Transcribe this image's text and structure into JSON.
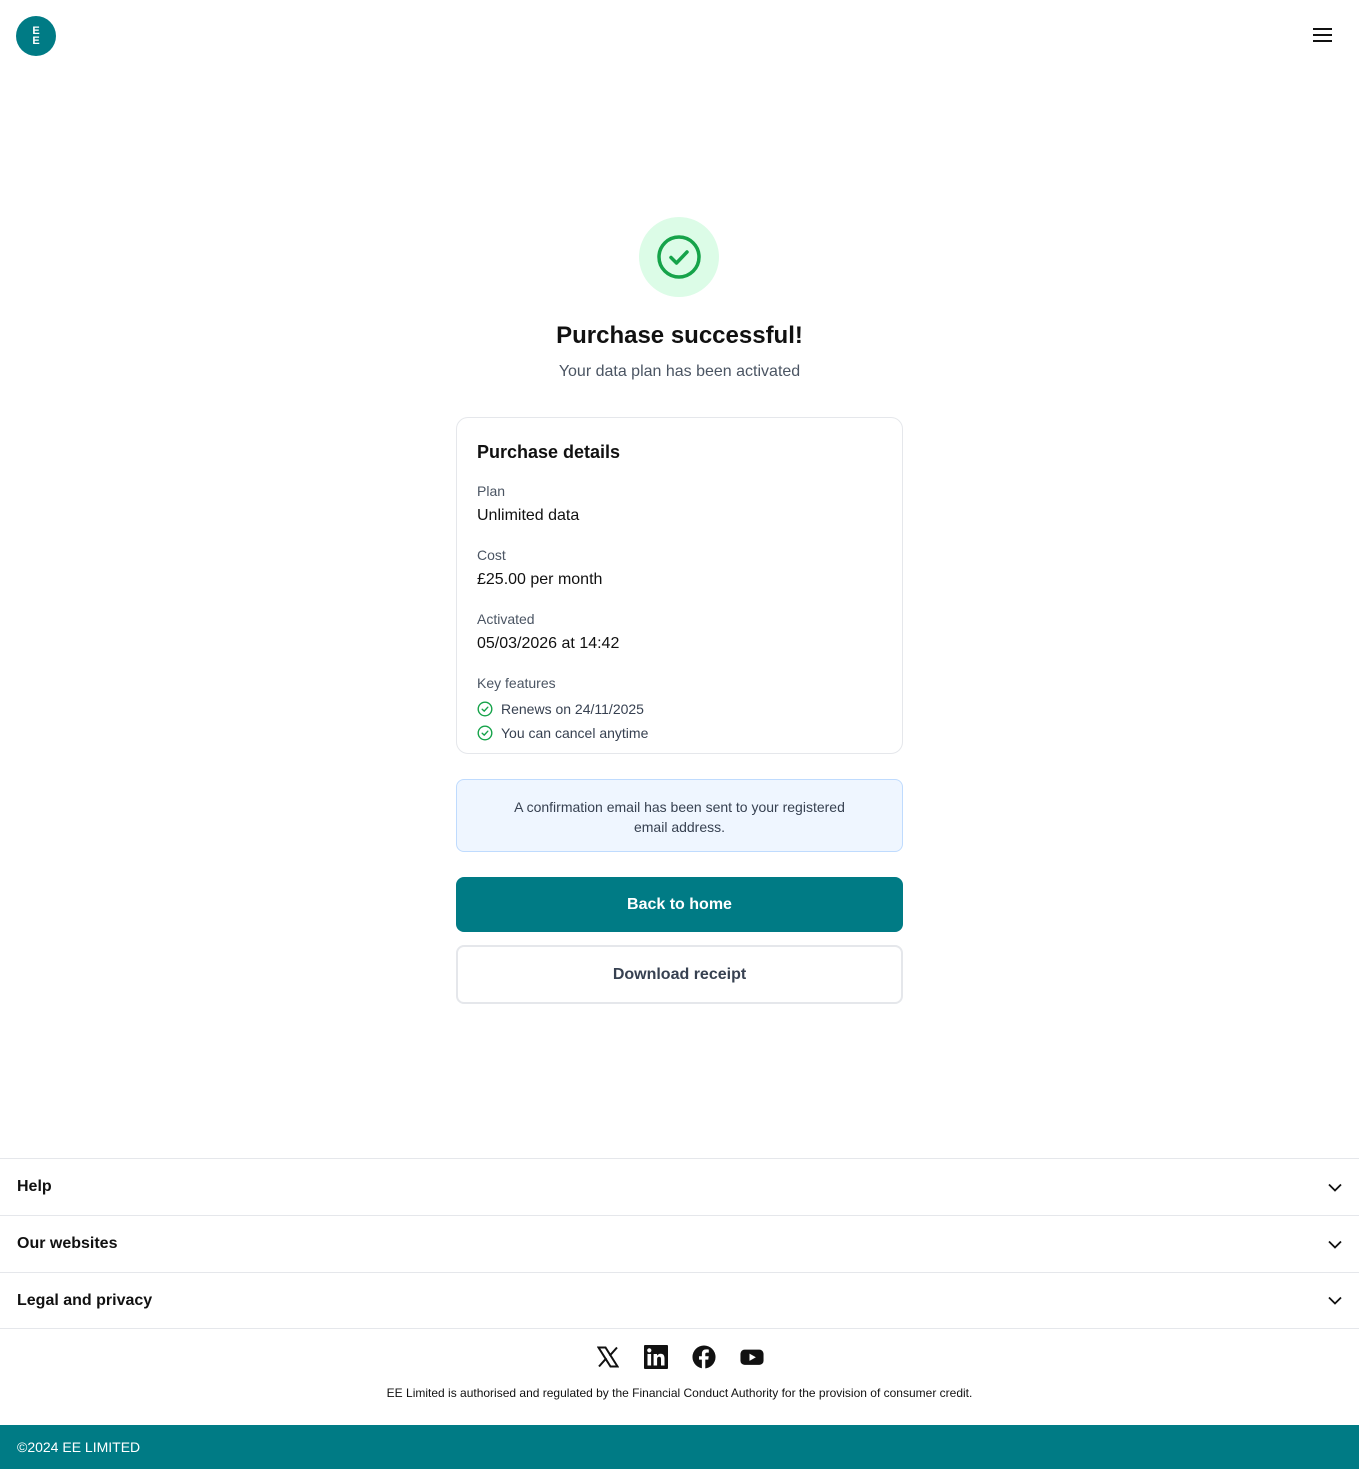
{
  "header": {
    "logo_line1": "E",
    "logo_line2": "E"
  },
  "main": {
    "title": "Purchase successful!",
    "subtitle": "Your data plan has been activated"
  },
  "card": {
    "title": "Purchase details",
    "plan_label": "Plan",
    "plan_value": "Unlimited data",
    "cost_label": "Cost",
    "cost_value": "£25.00 per month",
    "activated_label": "Activated",
    "activated_value": "05/03/2026 at 14:42",
    "features_label": "Key features",
    "features": [
      "Renews on 24/11/2025",
      "You can cancel anytime"
    ]
  },
  "notice": {
    "text": "A confirmation email has been sent to your registered email address."
  },
  "actions": {
    "primary_label": "Back to home",
    "secondary_label": "Download receipt"
  },
  "footer": {
    "sections": [
      "Help",
      "Our websites",
      "Legal and privacy"
    ],
    "social": [
      "x-icon",
      "linkedin-icon",
      "facebook-icon",
      "youtube-icon"
    ],
    "legal": "EE Limited is authorised and regulated by the Financial Conduct Authority for the provision of consumer credit.",
    "copyright": "©2024 EE LIMITED"
  },
  "colors": {
    "brand": "#007b85",
    "success": "#16a34a",
    "success_bg": "#dcfce7",
    "notice_bg": "#eff6ff"
  }
}
